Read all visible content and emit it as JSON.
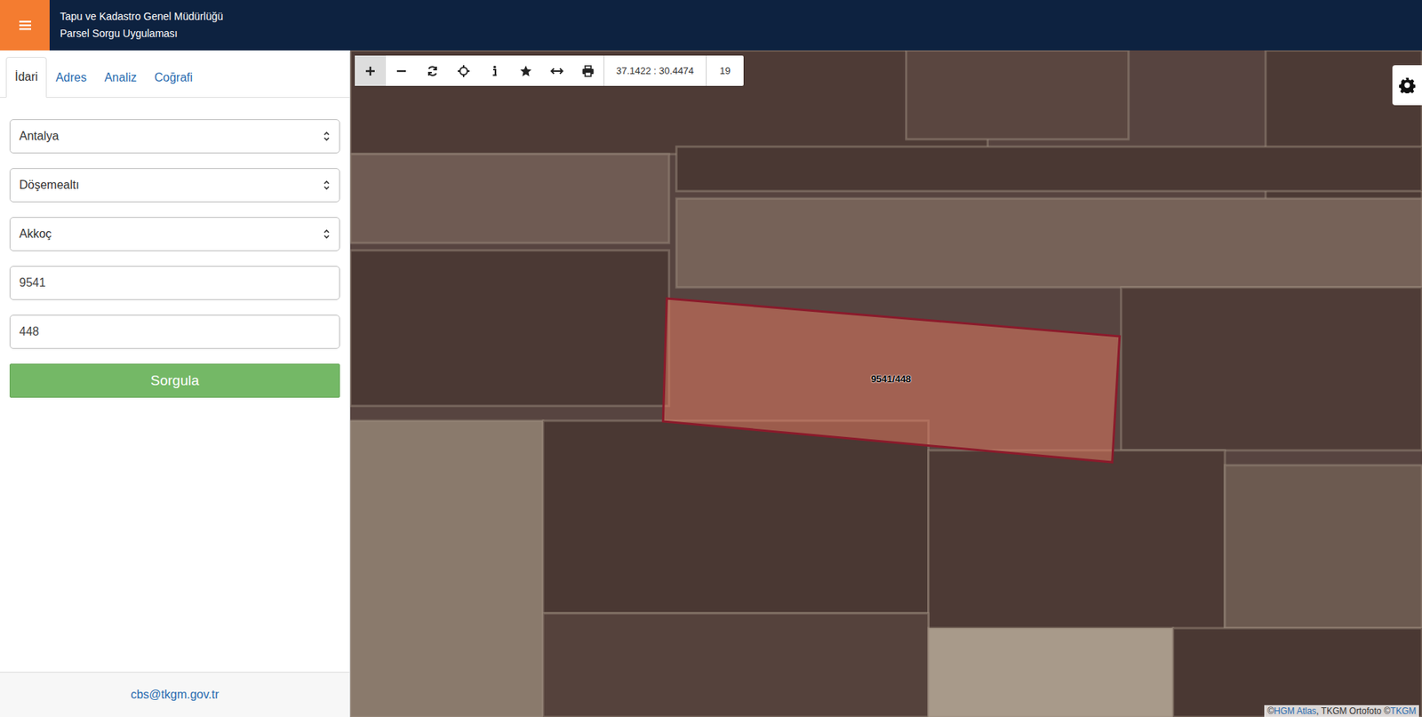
{
  "header": {
    "title_lines": [
      "Tapu ve Kadastro Genel Müdürlüğü",
      "Parsel Sorgu Uygulaması"
    ]
  },
  "tabs": [
    {
      "label": "İdari",
      "selected": true
    },
    {
      "label": "Adres",
      "selected": false
    },
    {
      "label": "Analiz",
      "selected": false
    },
    {
      "label": "Coğrafi",
      "selected": false
    }
  ],
  "fields": [
    {
      "kind": "select",
      "value": "Antalya"
    },
    {
      "kind": "select",
      "value": "Döşemealtı"
    },
    {
      "kind": "select",
      "value": "Akkoç"
    },
    {
      "kind": "input",
      "value": "9541"
    },
    {
      "kind": "input",
      "value": "448"
    }
  ],
  "submit_button": "Sorgula",
  "footer": {
    "email": "cbs@tkgm.gov.tr"
  },
  "toolbar": {
    "coordinates": "37.1422 : 30.4474",
    "zoom": "19"
  },
  "parcel": {
    "label": "9541/448"
  },
  "attribution": {
    "prefix": "©",
    "link1": "HGM Atlas",
    "middle": ", TKGM Ortofoto ©",
    "link2": "TKGM"
  }
}
